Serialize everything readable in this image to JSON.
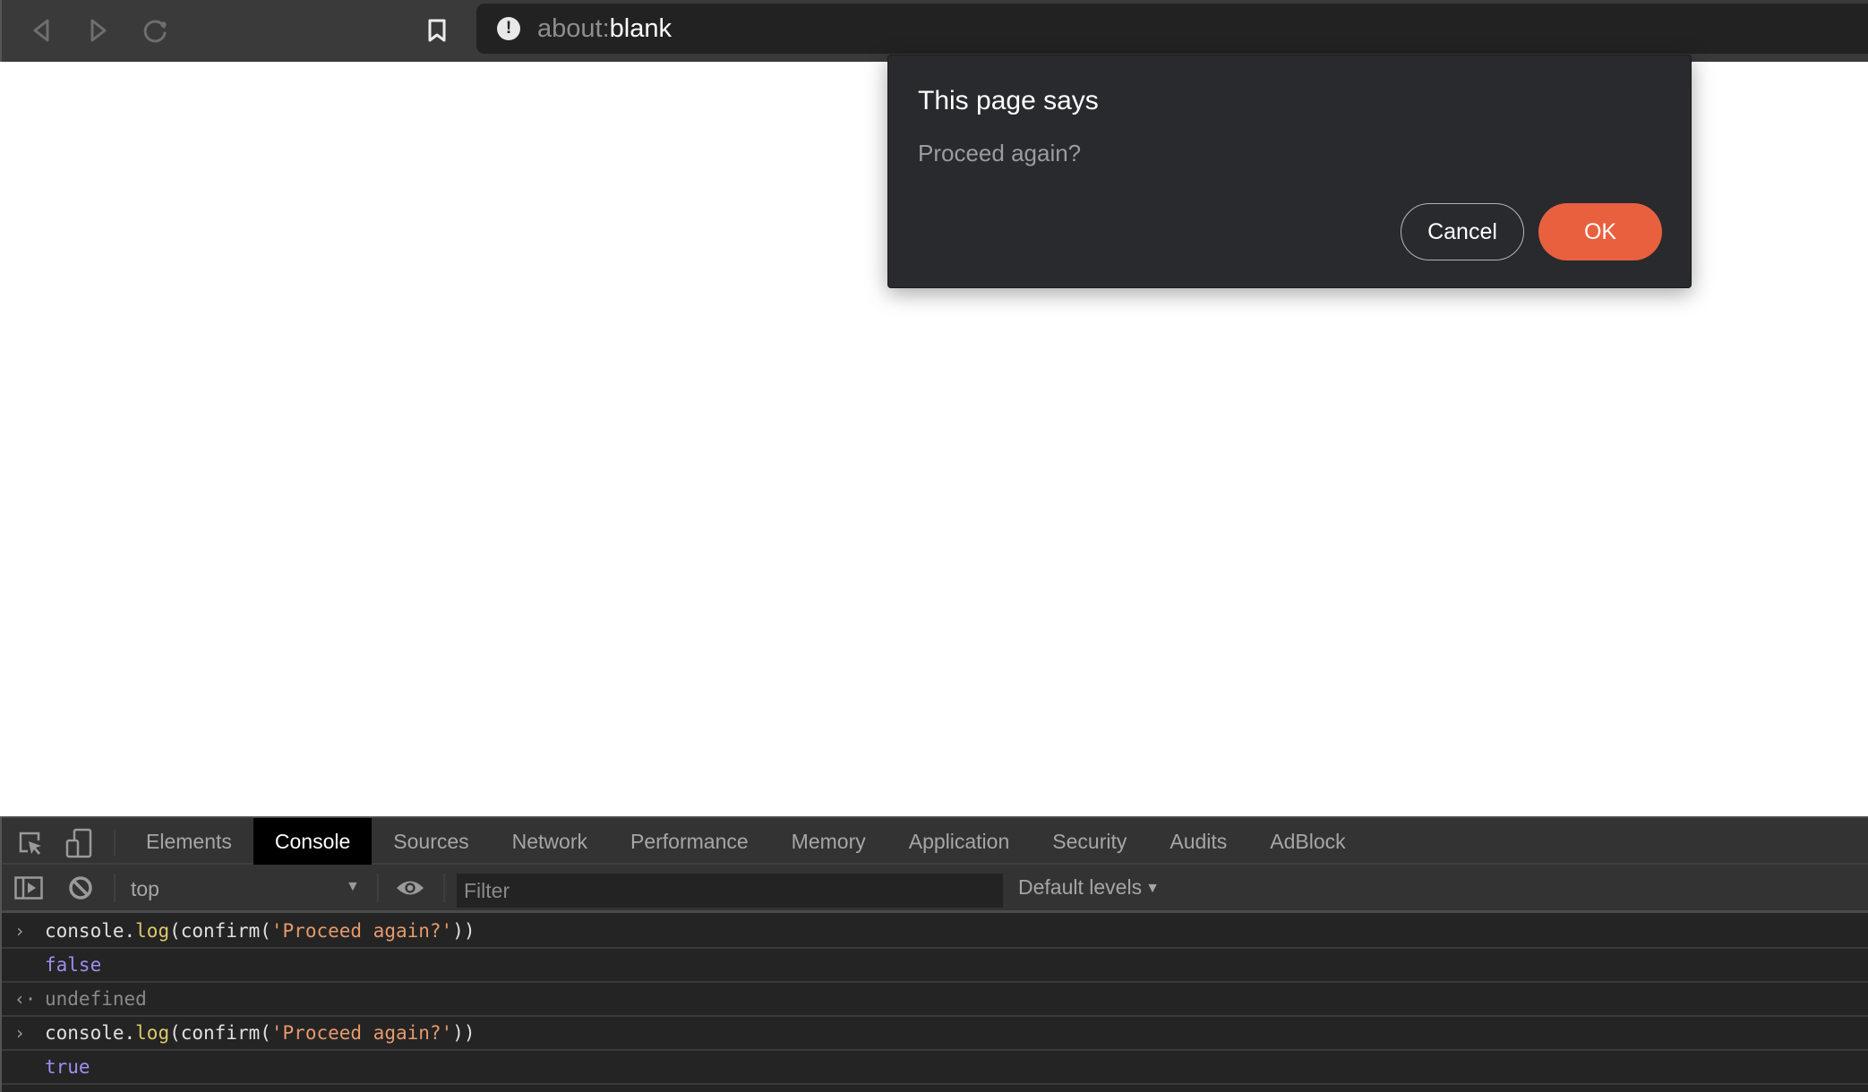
{
  "browser": {
    "nav": {
      "back_icon": "back-arrow-icon",
      "forward_icon": "forward-arrow-icon",
      "reload_icon": "reload-icon",
      "bookmark_icon": "bookmark-icon"
    },
    "url": {
      "info_icon": "!",
      "scheme": "about:",
      "host": "blank"
    }
  },
  "dialog": {
    "title": "This page says",
    "message": "Proceed again?",
    "cancel_label": "Cancel",
    "ok_label": "OK",
    "ok_color": "#e8603e"
  },
  "devtools": {
    "tabs": [
      {
        "label": "Elements",
        "active": false
      },
      {
        "label": "Console",
        "active": true
      },
      {
        "label": "Sources",
        "active": false
      },
      {
        "label": "Network",
        "active": false
      },
      {
        "label": "Performance",
        "active": false
      },
      {
        "label": "Memory",
        "active": false
      },
      {
        "label": "Application",
        "active": false
      },
      {
        "label": "Security",
        "active": false
      },
      {
        "label": "Audits",
        "active": false
      },
      {
        "label": "AdBlock",
        "active": false
      }
    ],
    "toolbar": {
      "context": "top",
      "context_arrow": "▼",
      "filter_placeholder": "Filter",
      "filter_value": "",
      "levels_label": "Default levels",
      "levels_arrow": "▼"
    },
    "console": {
      "rows": [
        {
          "kind": "input",
          "gutter": "›",
          "tokens": [
            {
              "t": "console.",
              "c": "plain"
            },
            {
              "t": "log",
              "c": "method"
            },
            {
              "t": "(confirm(",
              "c": "plain"
            },
            {
              "t": "'Proceed again?'",
              "c": "string"
            },
            {
              "t": "))",
              "c": "plain"
            }
          ]
        },
        {
          "kind": "output",
          "gutter": "",
          "tokens": [
            {
              "t": "false",
              "c": "bool"
            }
          ]
        },
        {
          "kind": "result",
          "gutter": "‹·",
          "tokens": [
            {
              "t": "undefined",
              "c": "undef"
            }
          ]
        },
        {
          "kind": "input",
          "gutter": "›",
          "tokens": [
            {
              "t": "console.",
              "c": "plain"
            },
            {
              "t": "log",
              "c": "method"
            },
            {
              "t": "(confirm(",
              "c": "plain"
            },
            {
              "t": "'Proceed again?'",
              "c": "string"
            },
            {
              "t": "))",
              "c": "plain"
            }
          ]
        },
        {
          "kind": "output",
          "gutter": "",
          "tokens": [
            {
              "t": "true",
              "c": "bool"
            }
          ]
        }
      ]
    }
  }
}
